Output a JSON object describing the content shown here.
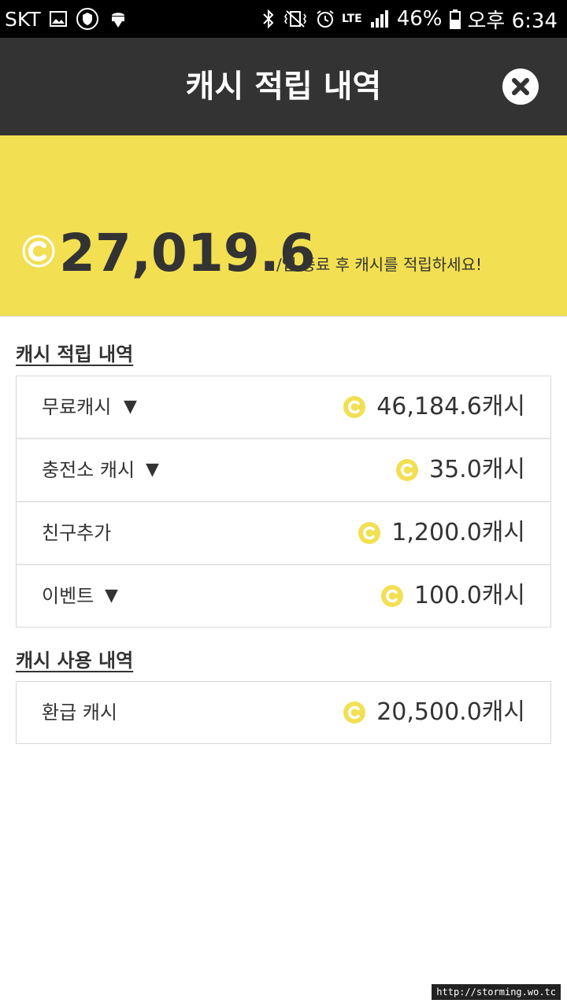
{
  "status_bar": {
    "carrier": "SKT",
    "network": "LTE",
    "battery": "46%",
    "time": "오후 6:34",
    "icons": [
      "gallery-icon",
      "shield-icon",
      "android-download-icon",
      "bluetooth-icon",
      "vibrate-icon",
      "alarm-icon",
      "signal-icon",
      "battery-icon"
    ]
  },
  "header": {
    "title": "캐시 적립 내역",
    "close_icon": "close-icon"
  },
  "balance": {
    "amount": "27,019.6",
    "note": "/앱 종료 후 캐시를 적립하세요!"
  },
  "earn_section": {
    "title": "캐시 적립 내역",
    "items": [
      {
        "label": "무료캐시",
        "has_dropdown": true,
        "value": "46,184.6캐시"
      },
      {
        "label": "충전소 캐시",
        "has_dropdown": true,
        "value": "35.0캐시"
      },
      {
        "label": "친구추가",
        "has_dropdown": false,
        "value": "1,200.0캐시"
      },
      {
        "label": "이벤트",
        "has_dropdown": true,
        "value": "100.0캐시"
      }
    ]
  },
  "use_section": {
    "title": "캐시 사용 내역",
    "items": [
      {
        "label": "환급 캐시",
        "has_dropdown": false,
        "value": "20,500.0캐시"
      }
    ]
  },
  "dropdown_glyph": "▼",
  "watermark": "http://storming.wo.tc",
  "colors": {
    "header_bg": "#333333",
    "banner_bg": "#f2df52",
    "coin": "#f2df52",
    "text": "#333333"
  }
}
